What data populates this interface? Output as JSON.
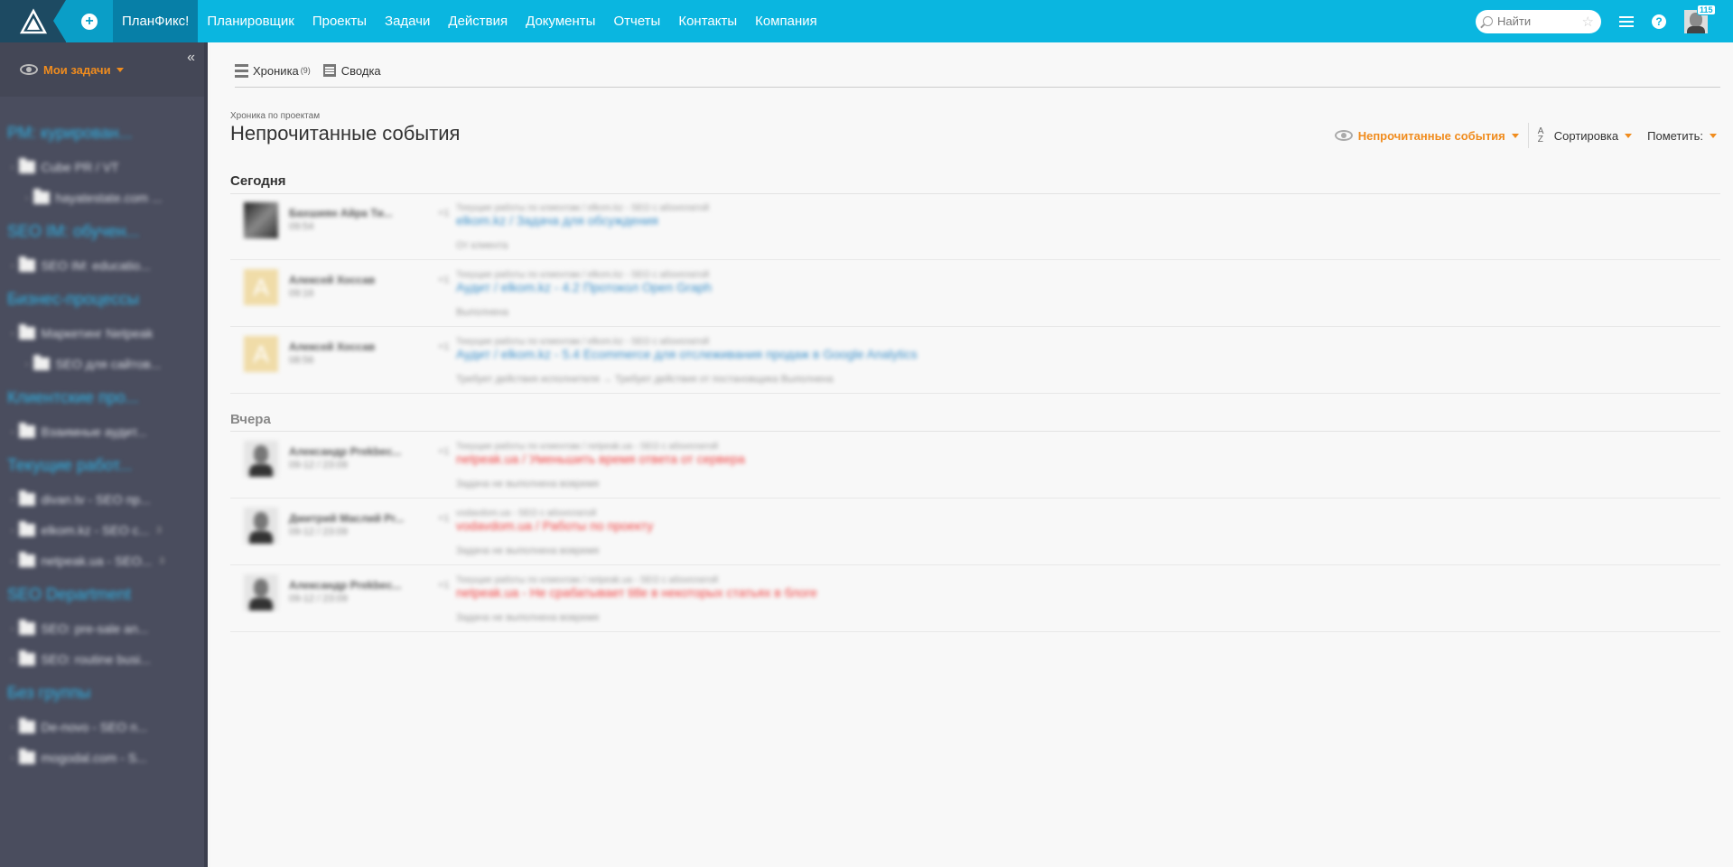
{
  "topbar": {
    "brand": "ПланФикс!",
    "nav": [
      "Планировщик",
      "Проекты",
      "Задачи",
      "Действия",
      "Документы",
      "Отчеты",
      "Контакты",
      "Компания"
    ],
    "search_placeholder": "Найти",
    "notification_count": "115",
    "accent_color": "#0ab6e0"
  },
  "sidebar": {
    "header_label": "Мои задачи",
    "collapse_glyph": "«",
    "groups": [
      {
        "title": "PM: куpирован...",
        "items": [
          {
            "label": "Cube PR / VT",
            "sub": false
          },
          {
            "label": "hayatestate.com ...",
            "sub": true
          }
        ]
      },
      {
        "title": "SEO IM: обучен...",
        "items": [
          {
            "label": "SEO IM: educatio...",
            "sub": false
          }
        ]
      },
      {
        "title": "Бизнес-процессы",
        "items": [
          {
            "label": "Маркетинг Netpeak",
            "sub": false
          },
          {
            "label": "SEO для сайтов...",
            "sub": true
          }
        ]
      },
      {
        "title": "Клиентские про...",
        "items": [
          {
            "label": "Взаимные аудит...",
            "sub": false
          }
        ]
      },
      {
        "title": "Текущие работ...",
        "items": [
          {
            "label": "divan.tv - SEO пр...",
            "sub": false
          },
          {
            "label": "elkom.kz - SEO с...",
            "sub": false,
            "count": "3"
          },
          {
            "label": "netpeak.ua - SEO...",
            "sub": false,
            "count": "3"
          }
        ]
      },
      {
        "title": "SEO Department",
        "items": [
          {
            "label": "SEO: pre-sale an...",
            "sub": false
          },
          {
            "label": "SEO: routine busi...",
            "sub": false
          }
        ]
      },
      {
        "title": "Без группы",
        "items": [
          {
            "label": "De-novo - SEO п...",
            "sub": false
          },
          {
            "label": "mogodal.com - S...",
            "sub": false
          }
        ]
      }
    ]
  },
  "main": {
    "tabs": [
      {
        "label": "Хроника",
        "badge": "(9)"
      },
      {
        "label": "Сводка"
      }
    ],
    "breadcrumb": "Хроника по проектам",
    "title": "Непрочитанные события",
    "filter_label": "Непрочитанные события",
    "sort_label": "Сортировка",
    "sort_icon": "A Z",
    "mark_label": "Пометить:",
    "today_label": "Сегодня",
    "yesterday_label": "Вчера",
    "today_events": [
      {
        "avatar": "dark",
        "name": "Бахшиян Айра Ти...",
        "time": "09:54",
        "meta": "Текущие работы по клиентам / elkom.kz - SEO с абонплатой",
        "link": "elkom.kz / Задача для обсуждения",
        "link_color": "blue",
        "note": "От клиента"
      },
      {
        "avatar": "letter",
        "letter": "A",
        "name": "Алексей Хоссав",
        "time": "09:16",
        "meta": "Текущие работы по клиентам / elkom.kz - SEO с абонплатой",
        "link": "Аудит / elkom.kz - 4.2 Протокол Open Graph",
        "link_color": "blue",
        "note": "Выполнена"
      },
      {
        "avatar": "letter",
        "letter": "A",
        "name": "Алексей Хоссав",
        "time": "08:56",
        "meta": "Текущие работы по клиентам / elkom.kz - SEO с абонплатой",
        "link": "Аудит / elkom.kz - 5.4 Ecommerce для отслеживания продаж в Google Analytics",
        "link_color": "blue",
        "note": "Требует действия исполнителя → Требует действия от постановщика Выполнена"
      }
    ],
    "yesterday_events": [
      {
        "avatar": "person",
        "name": "Александр Prekbec...",
        "time": "09-12 / 23:09",
        "meta": "Текущие работы по клиентам / netpeak.ua - SEO с абонплатой",
        "link": "netpeak.ua / Уменьшить время ответа от сервера",
        "link_color": "red",
        "note": "Задача не выполнена вовремя"
      },
      {
        "avatar": "person",
        "name": "Дмитрий Маслий Pr...",
        "time": "09-12 / 23:09",
        "meta": "vodavdom.ua - SEO с абонплатой",
        "link": "vodavdom.ua / Работы по проекту",
        "link_color": "red",
        "note": "Задача не выполнена вовремя"
      },
      {
        "avatar": "person",
        "name": "Александр Prekbec...",
        "time": "09-12 / 23:09",
        "meta": "Текущие работы по клиентам / netpeak.ua - SEO с абонплатой",
        "link": "netpeak.ua - Не срабатывает title в некоторых статьях в блоге",
        "link_color": "red",
        "note": "Задача не выполнена вовремя"
      }
    ]
  }
}
